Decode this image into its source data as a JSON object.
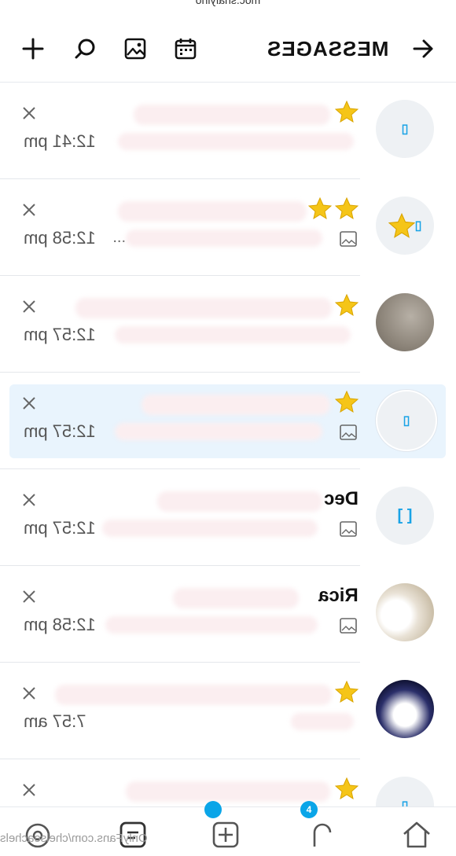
{
  "status_url": "moc.snafylno",
  "header": {
    "title": "MESSAGES",
    "icons": [
      "back-arrow-icon",
      "calendar-icon",
      "image-icon",
      "search-icon",
      "plus-icon"
    ]
  },
  "rows": [
    {
      "time": "12:41 pm",
      "preview_suffix": "",
      "stars": 1,
      "selected": false,
      "avatar": "placeholder"
    },
    {
      "time": "12:58 pm",
      "preview_suffix": "...",
      "stars": 2,
      "selected": false,
      "avatar": "placeholder-star"
    },
    {
      "time": "12:57 pm",
      "preview_suffix": "...",
      "stars": 1,
      "selected": false,
      "avatar": "photo-gray"
    },
    {
      "time": "12:57 pm",
      "preview_suffix": "...",
      "stars": 1,
      "selected": true,
      "avatar": "placeholder"
    },
    {
      "time": "12:57 pm",
      "preview_suffix": "...",
      "stars": 0,
      "selected": false,
      "avatar": "placeholder-bracket",
      "name_fragment": "Dec"
    },
    {
      "time": "12:58 pm",
      "preview_suffix": "...",
      "stars": 0,
      "selected": false,
      "avatar": "photo-light",
      "name_fragment": "Rica"
    },
    {
      "time": "7:57 am",
      "preview_suffix": "",
      "stars": 1,
      "selected": false,
      "avatar": "photo-dark"
    },
    {
      "time": "",
      "preview_suffix": "",
      "stars": 1,
      "selected": false,
      "avatar": "placeholder"
    }
  ],
  "bottom": {
    "watermark": "OnlyFans.com/chelseachels",
    "notifications_badge": "4"
  },
  "colors": {
    "accent": "#0aa5e8",
    "selected_bg": "#e9f4fd",
    "star": "#f5c518"
  }
}
